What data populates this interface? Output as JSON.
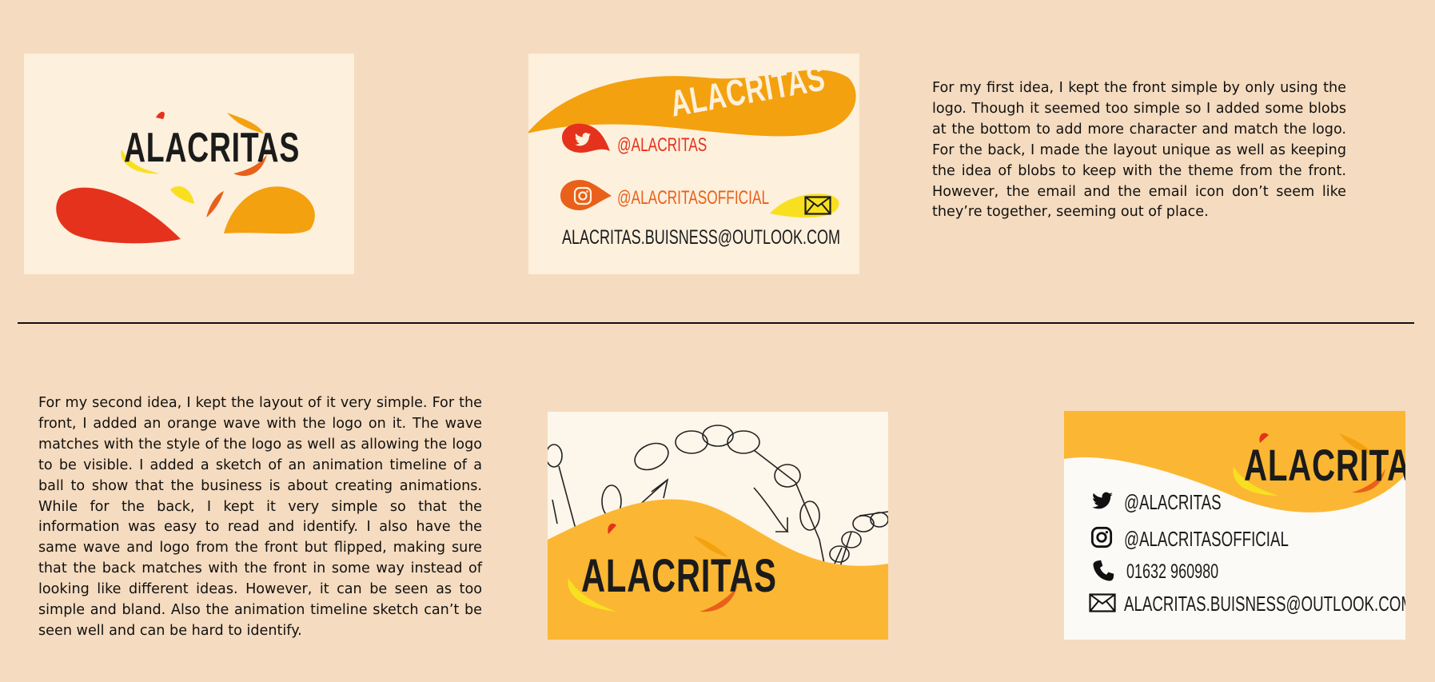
{
  "idea1": {
    "front": {
      "logo": "ALACRITAS"
    },
    "back": {
      "banner_title": "ALACRITAS",
      "twitter": "@ALACRITAS",
      "instagram": "@ALACRITASOFFICIAL",
      "email": "ALACRITAS.BUISNESS@OUTLOOK.COM"
    },
    "description": "For my first idea, I kept the front simple by only using the logo. Though it seemed too simple so I added some blobs at the bottom to add more character and match the logo. For the back, I made the layout unique as well as keeping the idea of blobs to keep with the theme from the front. However, the email and the email icon don’t seem like they’re together, seeming out of place."
  },
  "idea2": {
    "description": "For my second idea, I kept the layout of it very simple. For the front, I added an orange wave with the logo on it. The wave matches with the style of the logo as well as allowing the logo to be visible. I added a sketch of an animation timeline of a ball to show that the business is about creating animations. While for the back, I kept it very simple so that the information was easy to read and identify. I also have the same wave and logo from the front but flipped, making sure that the back matches with the front in some way instead of looking like different ideas. However, it can be seen as too simple and bland. Also the animation timeline sketch can’t be seen well and can be hard to identify.",
    "front": {
      "logo": "ALACRITAS"
    },
    "back": {
      "logo": "ALACRITAS",
      "twitter": "@ALACRITAS",
      "instagram": "@ALACRITASOFFICIAL",
      "phone": "01632 960980",
      "email": "ALACRITAS.BUISNESS@OUTLOOK.COM"
    }
  },
  "colors": {
    "page_bg": "#f5dbbf",
    "card_cream": "#fdf0dc",
    "orange": "#f3a10f",
    "red": "#e5321c",
    "yellow": "#f8e020",
    "wave_yellow": "#fbb733"
  }
}
